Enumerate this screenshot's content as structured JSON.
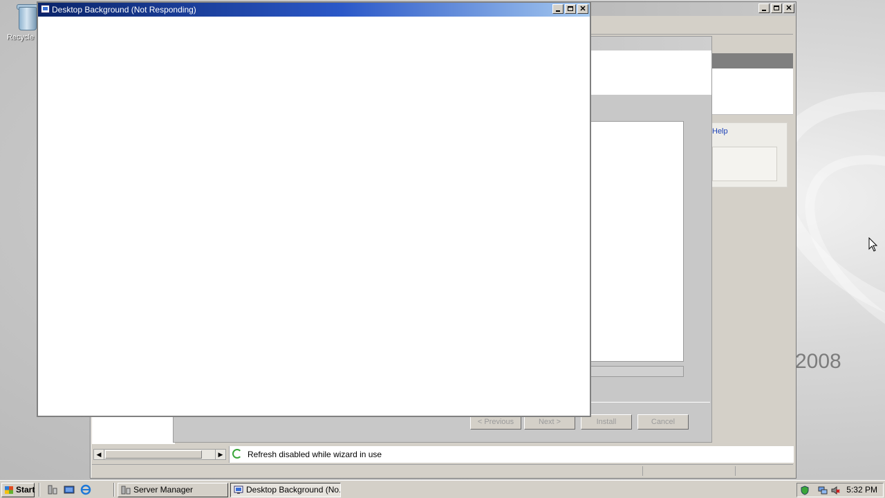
{
  "desktop": {
    "recycle_bin_label": "Recycle Bin",
    "brand_text": "2008"
  },
  "server_manager": {
    "help_link": "Help",
    "status_text": "Refresh disabled while wizard in use"
  },
  "wizard": {
    "previous_label": "< Previous",
    "next_label": "Next >",
    "install_label": "Install",
    "cancel_label": "Cancel"
  },
  "front_window": {
    "title": "Desktop Background (Not Responding)"
  },
  "taskbar": {
    "start_label": "Start",
    "tasks": [
      {
        "label": "Server Manager"
      },
      {
        "label": "Desktop Background (No..."
      }
    ],
    "clock": "5:32 PM"
  },
  "colors": {
    "titlebar_active": "#0a246a",
    "window_face": "#d4d0c8",
    "disabled_text": "#9a9a9a"
  }
}
